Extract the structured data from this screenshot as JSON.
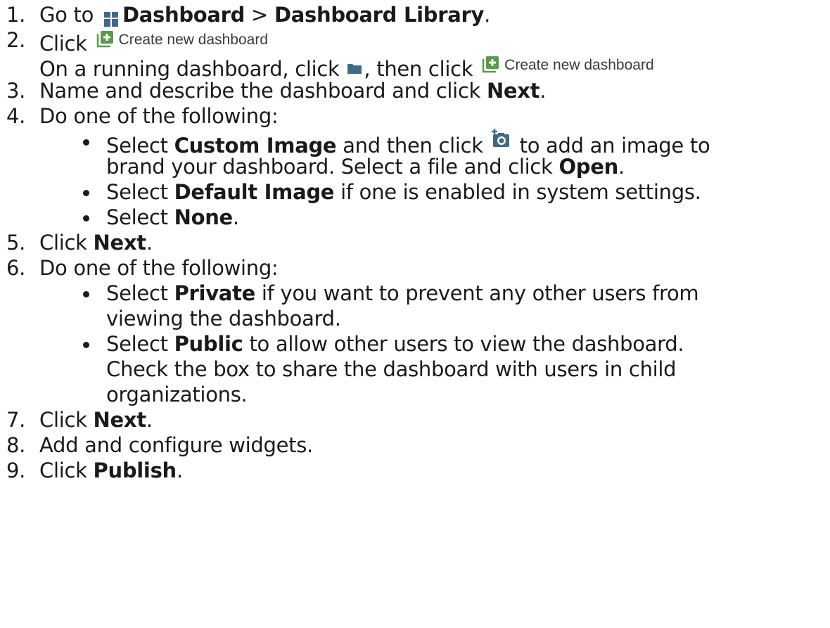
{
  "steps": [
    {
      "num": "1.",
      "pre": "Go to ",
      "b1": "Dashboard",
      "mid": " > ",
      "b2": "Dashboard Library",
      "post": "."
    },
    {
      "num": "2.",
      "pre": "Click ",
      "ui": "Create new dashboard"
    },
    {
      "sub_pre": "On a running dashboard, click ",
      "sub_mid": ", then click ",
      "ui": "Create new dashboard"
    },
    {
      "num": "3.",
      "pre": "Name and describe the dashboard and click ",
      "b1": "Next",
      "post": "."
    },
    {
      "num": "4.",
      "pre": "Do one of the following:"
    },
    {
      "num": "5.",
      "pre": "Click ",
      "b1": "Next",
      "post": "."
    },
    {
      "num": "6.",
      "pre": "Do one of the following:"
    },
    {
      "num": "7.",
      "pre": "Click ",
      "b1": "Next",
      "post": "."
    },
    {
      "num": "8.",
      "pre": "Add and configure widgets."
    },
    {
      "num": "9.",
      "pre": "Click ",
      "b1": "Publish",
      "post": "."
    }
  ],
  "bullets4": [
    {
      "pre": "Select ",
      "b": "Custom Image",
      "mid": " and then click ",
      "post": " to add an image to",
      "cont_pre": "brand your dashboard. Select a file and click ",
      "cont_b": "Open",
      "cont_post": "."
    },
    {
      "pre": "Select ",
      "b": "Default Image",
      "post": " if one is enabled in system settings."
    },
    {
      "pre": "Select ",
      "b": "None",
      "post": "."
    }
  ],
  "bullets6": [
    {
      "pre": "Select ",
      "b": "Private",
      "post": " if you want to prevent any other users from",
      "cont": "viewing the dashboard."
    },
    {
      "pre": "Select ",
      "b": "Public",
      "post": " to allow other users to view the dashboard.",
      "cont": "Check the box to share the dashboard with users in child",
      "cont2": "organizations."
    }
  ],
  "icons": {
    "dashboard": "dashboard-grid-icon",
    "create": "plus-square-icon",
    "folder": "folder-icon",
    "camera": "add-camera-icon"
  },
  "colors": {
    "text": "#1a1a1a",
    "icon_blue": "#3f6a88",
    "icon_green": "#5a9a4a",
    "ui_label": "#3a3a3a"
  }
}
